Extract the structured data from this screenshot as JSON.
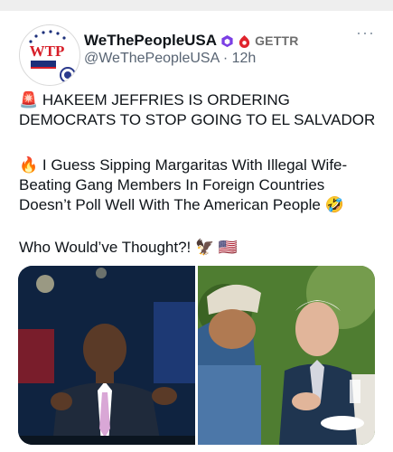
{
  "post": {
    "display_name": "WeThePeopleUSA",
    "source_label": "GETTR",
    "handle": "@WeThePeopleUSA",
    "separator": "·",
    "time_ago": "12h",
    "more_label": "···",
    "avatar_logo_text": "WTP",
    "paragraphs": [
      "🚨 HAKEEM JEFFRIES IS ORDERING DEMOCRATS TO STOP GOING TO EL SALVADOR",
      "🔥 I Guess Sipping Margaritas With Illegal Wife-Beating Gang Members In Foreign Countries Doesn’t Poll Well With The American People 🤣",
      "Who Would’ve Thought?! 🦅 🇺🇸"
    ]
  },
  "colors": {
    "text": "#0f1419",
    "muted": "#586473",
    "mod_badge": "#7b3fe4",
    "gettr_red": "#e0242d",
    "logo_blue": "#1c2f7a",
    "logo_red": "#d71e28"
  },
  "icons": [
    "avatar-logo",
    "moderator-badge-icon",
    "gettr-logo-icon",
    "more-options-icon"
  ]
}
